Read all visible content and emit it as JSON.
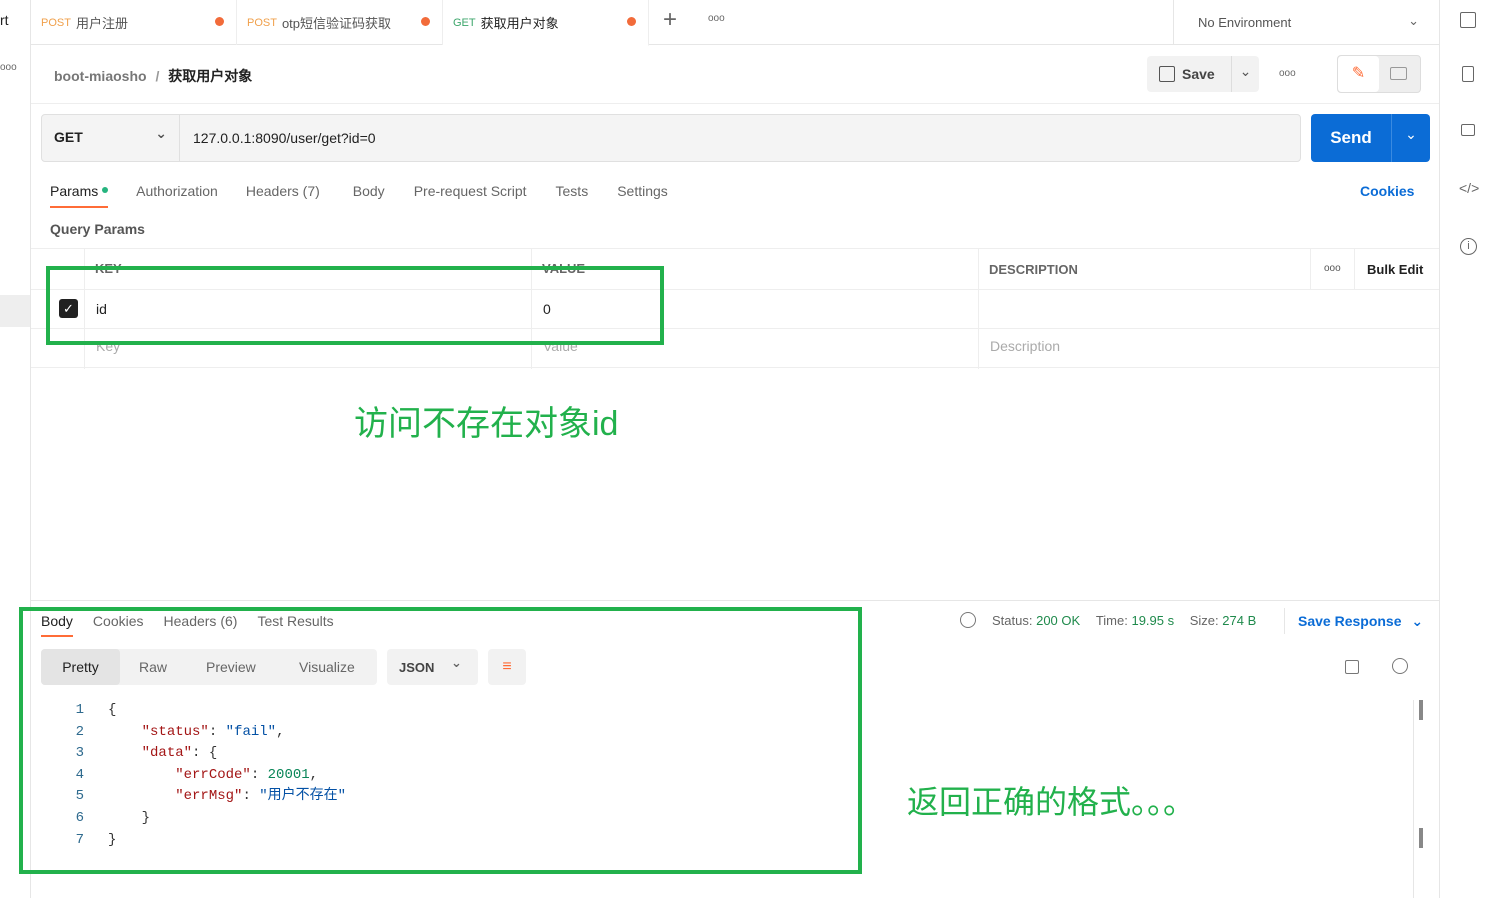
{
  "sidebar_partial": {
    "top_text": "rt",
    "more": "ooo"
  },
  "tabs": [
    {
      "method": "POST",
      "name": "用户注册",
      "method_color": "#f0a04b"
    },
    {
      "method": "POST",
      "name": "otp短信验证码获取",
      "method_color": "#f0a04b"
    },
    {
      "method": "GET",
      "name": "获取用户对象",
      "method_color": "#3ca66b"
    }
  ],
  "tabbar": {
    "add": "+",
    "more": "ooo",
    "environment": "No Environment"
  },
  "breadcrumb": {
    "collection": "boot-miaosho",
    "sep": "/",
    "request": "获取用户对象"
  },
  "toolbar": {
    "save": "Save",
    "more": "ooo"
  },
  "request": {
    "method": "GET",
    "url": "127.0.0.1:8090/user/get?id=0",
    "send": "Send"
  },
  "req_tabs": [
    "Params",
    "Authorization",
    "Headers (7)",
    "Body",
    "Pre-request Script",
    "Tests",
    "Settings"
  ],
  "cookies": "Cookies",
  "query_params": {
    "title": "Query Params",
    "headers": {
      "key": "KEY",
      "value": "VALUE",
      "description": "DESCRIPTION",
      "more": "ooo",
      "bulk": "Bulk Edit"
    },
    "rows": [
      {
        "key": "id",
        "value": "0",
        "checked": true
      }
    ],
    "placeholders": {
      "key": "Key",
      "value": "Value",
      "description": "Description"
    }
  },
  "annotations": {
    "top": "访问不存在对象id",
    "bottom": "返回正确的格式。。。"
  },
  "response": {
    "tabs": [
      "Body",
      "Cookies",
      "Headers (6)",
      "Test Results"
    ],
    "status_label": "Status:",
    "status": "200 OK",
    "time_label": "Time:",
    "time": "19.95 s",
    "size_label": "Size:",
    "size": "274 B",
    "save_response": "Save Response",
    "views": [
      "Pretty",
      "Raw",
      "Preview",
      "Visualize"
    ],
    "format": "JSON",
    "lines": [
      "1",
      "2",
      "3",
      "4",
      "5",
      "6",
      "7"
    ],
    "code": {
      "status_key": "\"status\"",
      "status_val": "\"fail\"",
      "data_key": "\"data\"",
      "errcode_key": "\"errCode\"",
      "errcode_val": "20001",
      "errmsg_key": "\"errMsg\"",
      "errmsg_val": "\"用户不存在\""
    }
  },
  "colors": {
    "accent": "#ff6c37",
    "send": "#0b6cd6",
    "annotation": "#22b14c"
  }
}
